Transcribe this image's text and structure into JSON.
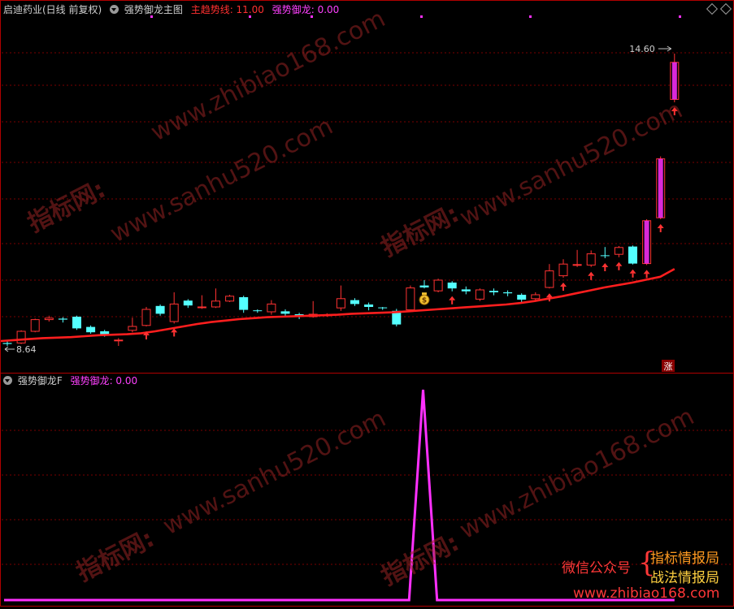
{
  "header_top": {
    "stock_title": "启迪药业(日线 前复权)",
    "indicator_name": "强势御龙主图",
    "line1_label": "主趋势线: 11.00",
    "line2_label": "强势御龙: 0.00"
  },
  "header_bottom": {
    "indicator_name": "强势御龙F",
    "line_label": "强势御龙: 0.00"
  },
  "price_labels": {
    "high": "14.60",
    "low": "8.64",
    "limit_up_badge": "涨"
  },
  "watermarks": {
    "url_a": "www.zhibiao168.com",
    "url_b": "www.sanhu520.com",
    "cn": "指标网:"
  },
  "promo": {
    "wechat": "微信公众号",
    "line1": "指标情报局",
    "line2": "战法情报局",
    "url": "www.zhibiao168.com"
  },
  "colors": {
    "up": "#ff3232",
    "down": "#54ffff",
    "ma": "#ff1e1e",
    "signal": "#ff30ff",
    "grid": "#7a0000",
    "divider": "#b00000"
  },
  "chart_data": {
    "type": "candlestick",
    "price_range": [
      8.3,
      15.2
    ],
    "candles": [
      [
        8.66,
        8.64,
        8.7,
        8.6
      ],
      [
        8.66,
        8.9,
        8.92,
        8.64
      ],
      [
        8.9,
        9.14,
        9.16,
        8.88
      ],
      [
        9.14,
        9.17,
        9.22,
        9.1
      ],
      [
        9.16,
        9.14,
        9.19,
        9.08
      ],
      [
        9.2,
        8.96,
        9.22,
        8.93
      ],
      [
        8.99,
        8.88,
        9.02,
        8.85
      ],
      [
        8.9,
        8.81,
        8.93,
        8.79
      ],
      [
        8.72,
        8.72,
        8.76,
        8.6
      ],
      [
        8.92,
        9.0,
        9.18,
        8.88
      ],
      [
        9.02,
        9.35,
        9.4,
        9.0
      ],
      [
        9.42,
        9.26,
        9.45,
        9.22
      ],
      [
        9.1,
        9.46,
        9.7,
        9.06
      ],
      [
        9.53,
        9.43,
        9.56,
        9.38
      ],
      [
        9.4,
        9.4,
        9.64,
        9.36
      ],
      [
        9.4,
        9.52,
        9.78,
        9.38
      ],
      [
        9.52,
        9.62,
        9.65,
        9.5
      ],
      [
        9.6,
        9.34,
        9.63,
        9.28
      ],
      [
        9.33,
        9.32,
        9.35,
        9.28
      ],
      [
        9.3,
        9.46,
        9.54,
        9.24
      ],
      [
        9.31,
        9.26,
        9.35,
        9.2
      ],
      [
        9.25,
        9.2,
        9.28,
        9.15
      ],
      [
        9.2,
        9.25,
        9.52,
        9.18
      ],
      [
        9.22,
        9.24,
        9.27,
        9.2
      ],
      [
        9.38,
        9.57,
        9.84,
        9.32
      ],
      [
        9.54,
        9.46,
        9.58,
        9.42
      ],
      [
        9.45,
        9.4,
        9.49,
        9.33
      ],
      [
        9.39,
        9.38,
        9.4,
        9.34
      ],
      [
        9.32,
        9.04,
        9.36,
        9.0
      ],
      [
        9.34,
        9.79,
        9.84,
        9.3
      ],
      [
        9.84,
        9.8,
        9.95,
        9.78
      ],
      [
        9.73,
        9.95,
        9.98,
        9.7
      ],
      [
        9.9,
        9.78,
        9.93,
        9.72
      ],
      [
        9.76,
        9.72,
        9.82,
        9.66
      ],
      [
        9.56,
        9.75,
        9.78,
        9.52
      ],
      [
        9.73,
        9.7,
        9.78,
        9.64
      ],
      [
        9.7,
        9.68,
        9.74,
        9.62
      ],
      [
        9.65,
        9.55,
        9.68,
        9.5
      ],
      [
        9.57,
        9.65,
        9.7,
        9.54
      ],
      [
        9.8,
        10.14,
        10.28,
        9.78
      ],
      [
        10.04,
        10.28,
        10.38,
        10.0
      ],
      [
        10.26,
        10.27,
        10.57,
        10.22
      ],
      [
        10.26,
        10.49,
        10.56,
        10.22
      ],
      [
        10.46,
        10.45,
        10.63,
        10.4
      ],
      [
        10.48,
        10.62,
        10.65,
        10.42
      ],
      [
        10.64,
        10.29,
        10.66,
        10.27
      ],
      [
        10.29,
        11.17,
        11.2,
        10.26
      ],
      [
        11.23,
        12.44,
        12.49,
        11.2
      ],
      [
        13.66,
        14.42,
        14.6,
        13.6
      ]
    ],
    "ma_line": [
      8.7,
      8.72,
      8.74,
      8.76,
      8.77,
      8.78,
      8.8,
      8.82,
      8.83,
      8.84,
      8.86,
      8.9,
      8.95,
      9.0,
      9.05,
      9.09,
      9.12,
      9.15,
      9.17,
      9.19,
      9.2,
      9.21,
      9.22,
      9.23,
      9.24,
      9.26,
      9.27,
      9.28,
      9.29,
      9.31,
      9.33,
      9.35,
      9.37,
      9.39,
      9.41,
      9.43,
      9.45,
      9.48,
      9.52,
      9.57,
      9.62,
      9.68,
      9.74,
      9.8,
      9.85,
      9.9,
      9.96,
      10.02,
      10.18
    ],
    "up_arrow_indices": [
      10,
      12,
      32,
      39,
      40,
      42,
      43,
      44,
      45,
      46,
      47,
      48
    ],
    "money_icon_index": 30,
    "signal_series": [
      0,
      0,
      0,
      0,
      0,
      0,
      0,
      0,
      0,
      0,
      0,
      0,
      0,
      0,
      0,
      0,
      0,
      0,
      0,
      0,
      0,
      0,
      0,
      0,
      0,
      0,
      0,
      0,
      0,
      0,
      1,
      0,
      0,
      0,
      0,
      0,
      0,
      0,
      0,
      0,
      0,
      0,
      0,
      0,
      0,
      0,
      0,
      0,
      0
    ]
  }
}
